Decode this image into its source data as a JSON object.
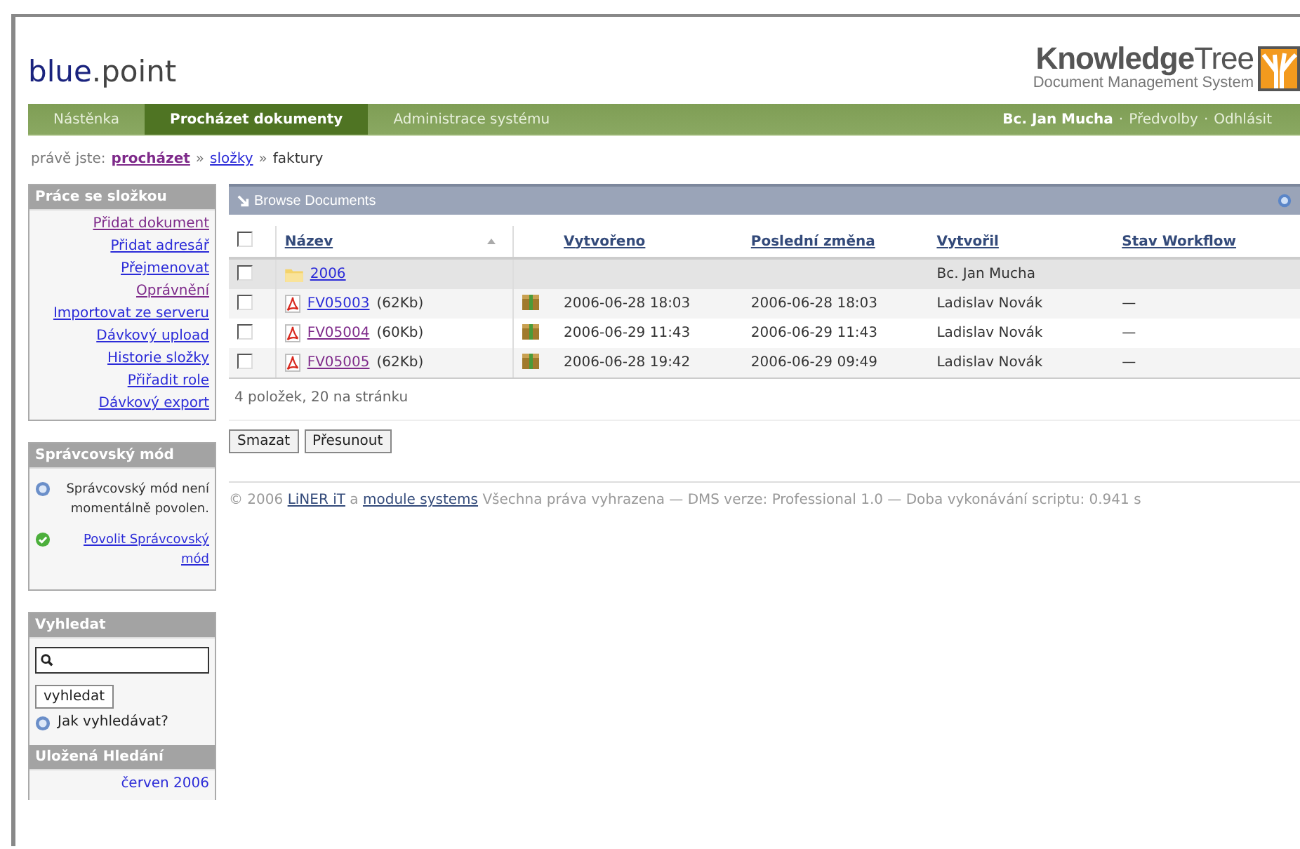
{
  "header": {
    "brand_main": "blue",
    "brand_dot": ".",
    "brand_rest": "point",
    "logo_title_bold": "Knowledge",
    "logo_title_light": "Tree",
    "logo_subtitle": "Document Management System"
  },
  "nav": {
    "tabs": [
      {
        "label": "Nástěnka",
        "selected": false
      },
      {
        "label": "Procházet dokumenty",
        "selected": true
      },
      {
        "label": "Administrace systému",
        "selected": false
      }
    ],
    "user": "Bc. Jan Mucha",
    "separator_1": "·",
    "preferences": "Předvolby",
    "separator_2": "·",
    "logout": "Odhlásit"
  },
  "breadcrumb": {
    "label": "právě jste:",
    "parts": [
      {
        "kind": "link",
        "text": "procházet",
        "bold": true,
        "visited": true
      },
      {
        "kind": "sep",
        "text": "»"
      },
      {
        "kind": "link",
        "text": "složky",
        "bold": false,
        "visited": false
      },
      {
        "kind": "sep",
        "text": "»"
      },
      {
        "kind": "text",
        "text": "faktury"
      }
    ]
  },
  "sidebar": {
    "actions": {
      "title": "Práce se složkou",
      "items": [
        {
          "label": "Přidat dokument",
          "visited": true
        },
        {
          "label": "Přidat adresář",
          "visited": false
        },
        {
          "label": "Přejmenovat",
          "visited": false
        },
        {
          "label": "Oprávnění",
          "visited": true
        },
        {
          "label": "Importovat ze serveru",
          "visited": false
        },
        {
          "label": "Dávkový upload",
          "visited": false
        },
        {
          "label": "Historie složky",
          "visited": false
        },
        {
          "label": "Přiřadit role",
          "visited": false
        },
        {
          "label": "Dávkový export",
          "visited": false
        }
      ]
    },
    "admin": {
      "title": "Správcovský mód",
      "info": "Správcovský mód není momentálně povolen.",
      "enable_link": "Povolit Správcovský mód"
    },
    "search": {
      "title": "Vyhledat",
      "button": "vyhledat",
      "help": "Jak vyhledávat?"
    },
    "saved": {
      "title": "Uložená Hledání",
      "items": [
        "červen 2006"
      ]
    }
  },
  "browse": {
    "title": "Browse Documents",
    "all_checked": false,
    "columns": [
      {
        "label": "Název",
        "sorted": true
      },
      {
        "label": "Vytvořeno",
        "sorted": false
      },
      {
        "label": "Poslední změna",
        "sorted": false
      },
      {
        "label": "Vytvořil",
        "sorted": false
      },
      {
        "label": "Stav Workflow",
        "sorted": false
      }
    ],
    "rows": [
      {
        "kind": "folder",
        "checked": false,
        "name": "2006",
        "visited": false,
        "creator": "Bc. Jan Mucha"
      },
      {
        "kind": "file",
        "checked": false,
        "name": "FV05003",
        "visited": false,
        "size": "(62Kb)",
        "created": "2006-06-28 18:03",
        "modified": "2006-06-28 18:03",
        "creator": "Ladislav Novák",
        "workflow": "—"
      },
      {
        "kind": "file",
        "checked": false,
        "name": "FV05004",
        "visited": true,
        "size": "(60Kb)",
        "created": "2006-06-29 11:43",
        "modified": "2006-06-29 11:43",
        "creator": "Ladislav Novák",
        "workflow": "—"
      },
      {
        "kind": "file",
        "checked": false,
        "name": "FV05005",
        "visited": true,
        "size": "(62Kb)",
        "created": "2006-06-28 19:42",
        "modified": "2006-06-29 09:49",
        "creator": "Ladislav Novák",
        "workflow": "—"
      }
    ],
    "count": "4 položek, 20 na stránku",
    "buttons": [
      "Smazat",
      "Přesunout"
    ]
  },
  "footer": {
    "parts": [
      {
        "kind": "text",
        "text": "© 2006 "
      },
      {
        "kind": "link",
        "text": "LiNER iT"
      },
      {
        "kind": "text",
        "text": " a "
      },
      {
        "kind": "link",
        "text": "module systems"
      },
      {
        "kind": "text",
        "text": " Všechna práva vyhrazena — DMS verze: Professional 1.0 — Doba vykonávání scriptu: 0.941 s"
      }
    ]
  }
}
